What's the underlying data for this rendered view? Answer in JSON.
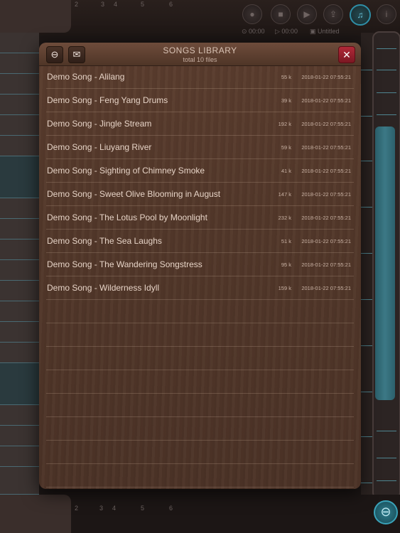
{
  "background": {
    "ruler_top": [
      "2",
      "3",
      "4",
      "5",
      "6"
    ],
    "ruler_bottom": [
      "2",
      "3",
      "4",
      "5",
      "6"
    ],
    "status": {
      "time_1": "⊙ 00:00",
      "time_2": "▷ 00:00",
      "doc_title": "Untitled"
    },
    "toolbar": {
      "record_icon": "●",
      "stop_icon": "■",
      "play_icon": "▶",
      "upload_icon": "⇪",
      "music_icon": "♫",
      "info_icon": "i"
    },
    "zoom_icon": "⊖"
  },
  "dialog": {
    "title": "SONGS LIBRARY",
    "subtitle": "total 10 files",
    "delete_icon": "⊖",
    "mail_icon": "✉",
    "close_icon": "✕",
    "songs": [
      {
        "name": "Demo Song - Alilang",
        "size": "55 k",
        "date": "2018-01-22 07:55:21"
      },
      {
        "name": "Demo Song - Feng Yang Drums",
        "size": "39 k",
        "date": "2018-01-22 07:55:21"
      },
      {
        "name": "Demo Song - Jingle Stream",
        "size": "192 k",
        "date": "2018-01-22 07:55:21"
      },
      {
        "name": "Demo Song - Liuyang River",
        "size": "59 k",
        "date": "2018-01-22 07:55:21"
      },
      {
        "name": "Demo Song - Sighting of Chimney Smoke",
        "size": "41 k",
        "date": "2018-01-22 07:55:21"
      },
      {
        "name": "Demo Song - Sweet Olive Blooming in August",
        "size": "147 k",
        "date": "2018-01-22 07:55:21"
      },
      {
        "name": "Demo Song - The Lotus Pool by Moonlight",
        "size": "232 k",
        "date": "2018-01-22 07:55:21"
      },
      {
        "name": "Demo Song - The Sea Laughs",
        "size": "51 k",
        "date": "2018-01-22 07:55:21"
      },
      {
        "name": "Demo Song - The Wandering Songstress",
        "size": "95 k",
        "date": "2018-01-22 07:55:21"
      },
      {
        "name": "Demo Song - Wilderness  Idyll",
        "size": "159 k",
        "date": "2018-01-22 07:55:21"
      }
    ]
  }
}
